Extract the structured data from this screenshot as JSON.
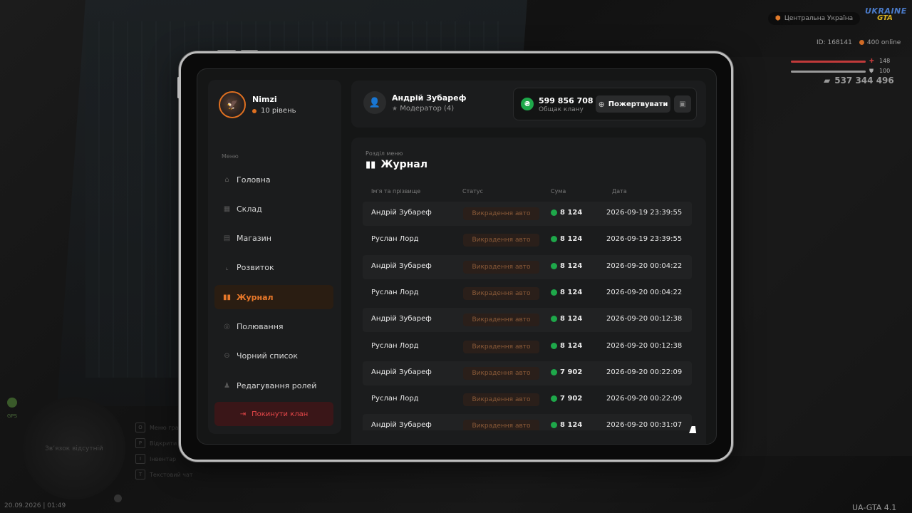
{
  "hud": {
    "location": "Центральна Україна",
    "logo_top": "UKRAINE",
    "logo_bottom": "GTA",
    "player_id": "ID: 168141",
    "online": "400 online",
    "health": "148",
    "armor": "100",
    "money": "537 344 496",
    "colors": {
      "health": "#c23a3a",
      "armor": "#9a9a9a"
    }
  },
  "bottom_hud": {
    "gps_label": "GPS",
    "minimap_text": "Зв’язок відсутній",
    "hotkeys": [
      {
        "key": "O",
        "label": "Меню гравця"
      },
      {
        "key": "P",
        "label": "Відкрити телефон"
      },
      {
        "key": "I",
        "label": "Інвентар"
      },
      {
        "key": "T",
        "label": "Текстовий чат"
      }
    ],
    "clock": "20.09.2026 | 01:49",
    "version": "UA-GTA 4.1"
  },
  "profile": {
    "name": "Nimzi",
    "level": "10 рівень"
  },
  "menu": {
    "caption": "Меню",
    "items": [
      {
        "label": "Головна",
        "icon": "home-icon"
      },
      {
        "label": "Склад",
        "icon": "warehouse-icon"
      },
      {
        "label": "Магазин",
        "icon": "shop-icon"
      },
      {
        "label": "Розвиток",
        "icon": "chart-icon"
      },
      {
        "label": "Журнал",
        "icon": "book-icon",
        "active": true
      },
      {
        "label": "Полювання",
        "icon": "target-icon"
      },
      {
        "label": "Чорний список",
        "icon": "block-icon"
      },
      {
        "label": "Редагування ролей",
        "icon": "user-edit-icon"
      }
    ],
    "leave_label": "Покинути клан"
  },
  "user": {
    "name": "Андрій Зубареф",
    "role": "Модератор (4)"
  },
  "bank": {
    "amount": "599 856 708",
    "label": "Общак клану",
    "donate_label": "Пожертвувати",
    "currency_symbol": "₴"
  },
  "section": {
    "caption": "Розділ меню",
    "title": "Журнал"
  },
  "table": {
    "headers": {
      "name": "Ім'я та прізвище",
      "status": "Статус",
      "sum": "Сума",
      "date": "Дата"
    },
    "rows": [
      {
        "name": "Андрій Зубареф",
        "status": "Викрадення авто",
        "sum": "8 124",
        "date": "2026-09-19 23:39:55"
      },
      {
        "name": "Руслан Лорд",
        "status": "Викрадення авто",
        "sum": "8 124",
        "date": "2026-09-19 23:39:55"
      },
      {
        "name": "Андрій Зубареф",
        "status": "Викрадення авто",
        "sum": "8 124",
        "date": "2026-09-20 00:04:22"
      },
      {
        "name": "Руслан Лорд",
        "status": "Викрадення авто",
        "sum": "8 124",
        "date": "2026-09-20 00:04:22"
      },
      {
        "name": "Андрій Зубареф",
        "status": "Викрадення авто",
        "sum": "8 124",
        "date": "2026-09-20 00:12:38"
      },
      {
        "name": "Руслан Лорд",
        "status": "Викрадення авто",
        "sum": "8 124",
        "date": "2026-09-20 00:12:38"
      },
      {
        "name": "Андрій Зубареф",
        "status": "Викрадення авто",
        "sum": "7 902",
        "date": "2026-09-20 00:22:09"
      },
      {
        "name": "Руслан Лорд",
        "status": "Викрадення авто",
        "sum": "7 902",
        "date": "2026-09-20 00:22:09"
      },
      {
        "name": "Андрій Зубареф",
        "status": "Викрадення авто",
        "sum": "8 124",
        "date": "2026-09-20 00:31:07"
      }
    ]
  }
}
